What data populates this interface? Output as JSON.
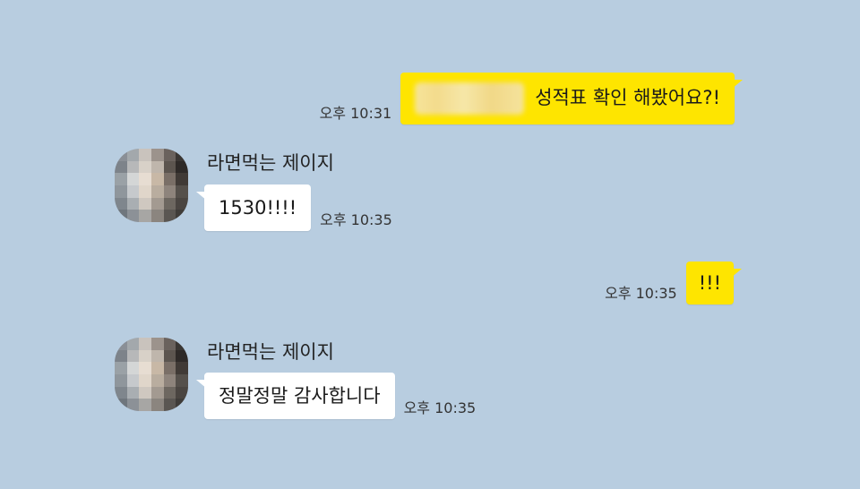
{
  "messages": [
    {
      "id": "m1",
      "side": "mine",
      "text": "성적표 확인 해봤어요?!",
      "has_redacted_prefix": true,
      "time": "오후 10:31"
    },
    {
      "id": "m2",
      "side": "theirs",
      "sender": "라면먹는 제이지",
      "text": "1530!!!!",
      "time": "오후 10:35"
    },
    {
      "id": "m3",
      "side": "mine",
      "text": "!!!",
      "time": "오후 10:35"
    },
    {
      "id": "m4",
      "side": "theirs",
      "sender": "라면먹는 제이지",
      "text": "정말정말 감사합니다",
      "time": "오후 10:35"
    }
  ],
  "colors": {
    "background": "#b8cde0",
    "my_bubble": "#fee500",
    "their_bubble": "#ffffff"
  }
}
